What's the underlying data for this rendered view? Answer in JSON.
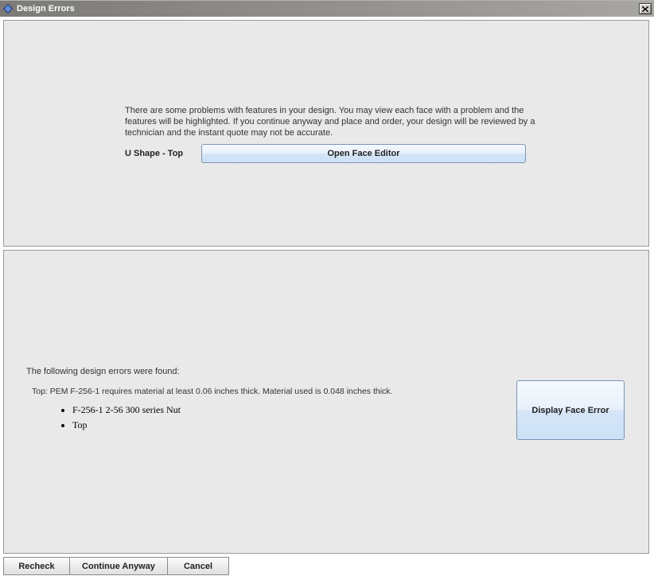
{
  "window": {
    "title": "Design Errors"
  },
  "top": {
    "info_text": "There are some problems with features in your design. You may view each face with a problem and the features will be highlighted. If you continue anyway and place and order, your design will be reviewed by a technician and the instant quote may not be accurate.",
    "face_label": "U Shape - Top",
    "open_face_btn": "Open Face Editor"
  },
  "bottom": {
    "heading": "The following design errors were found:",
    "detail": "Top: PEM F-256-1 requires material at least 0.06 inches thick. Material used is 0.048 inches thick.",
    "items": {
      "0": "F-256-1 2-56 300 series Nut",
      "1": "Top"
    },
    "display_btn": "Display Face Error"
  },
  "buttons": {
    "recheck": "Recheck",
    "continue": "Continue Anyway",
    "cancel": "Cancel"
  }
}
